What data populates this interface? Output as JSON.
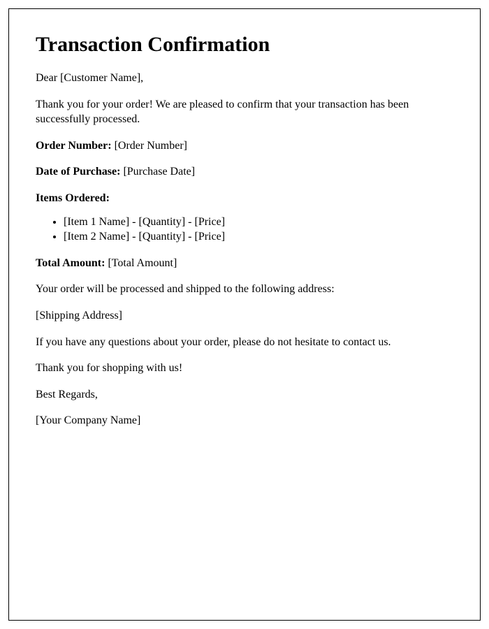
{
  "title": "Transaction Confirmation",
  "greeting": "Dear [Customer Name],",
  "intro": "Thank you for your order! We are pleased to confirm that your transaction has been successfully processed.",
  "orderNumberLabel": "Order Number:",
  "orderNumberValue": " [Order Number]",
  "dateLabel": "Date of Purchase:",
  "dateValue": " [Purchase Date]",
  "itemsLabel": "Items Ordered:",
  "items": [
    "[Item 1 Name] - [Quantity] - [Price]",
    "[Item 2 Name] - [Quantity] - [Price]"
  ],
  "totalLabel": "Total Amount:",
  "totalValue": " [Total Amount]",
  "shippingIntro": "Your order will be processed and shipped to the following address:",
  "shippingAddress": "[Shipping Address]",
  "questions": "If you have any questions about your order, please do not hesitate to contact us.",
  "thanks": "Thank you for shopping with us!",
  "closing": "Best Regards,",
  "company": "[Your Company Name]"
}
